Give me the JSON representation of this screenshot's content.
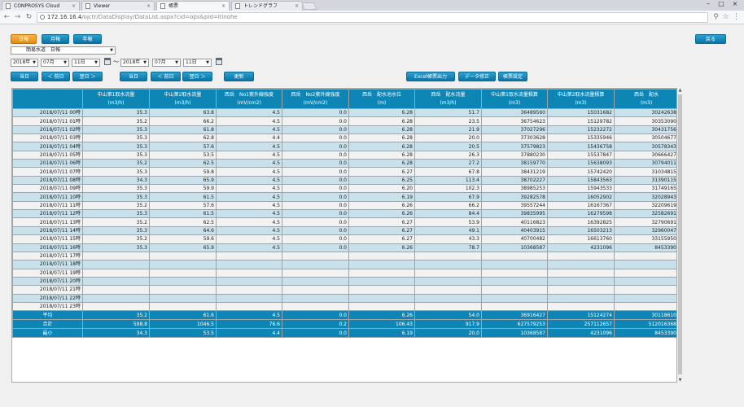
{
  "browser": {
    "tabs": [
      {
        "label": "CONPROSYS Cloud"
      },
      {
        "label": "Viewer"
      },
      {
        "label": "帳票"
      },
      {
        "label": "トレンドグラフ"
      }
    ],
    "address_host": "172.16.16.4",
    "address_path": "/ojctr/DataDisplay/DataList.aspx?cid=ops&pid=itinohe"
  },
  "controls": {
    "mode_daily": "日報",
    "mode_monthly": "月報",
    "mode_yearly": "年報",
    "back_button": "戻る",
    "facility_select": "簡易水道　日報",
    "from": {
      "year": "2018年",
      "month": "07月",
      "day": "11日"
    },
    "tilde": "～",
    "to": {
      "year": "2018年",
      "month": "07月",
      "day": "11日"
    },
    "from_today": "当日",
    "from_prev": "＜ 前日",
    "from_next": "翌日 ＞",
    "to_today": "当日",
    "to_prev": "＜ 前日",
    "to_next": "翌日 ＞",
    "refresh": "更新",
    "excel_export": "Excel帳票出力",
    "data_edit": "データ修正",
    "report_settings": "帳票設定"
  },
  "table": {
    "columns": [
      "",
      "中山第1取水流量\n(m3/h)",
      "中山第2取水流量\n(m3/h)",
      "西岳　No1紫外線強度\n(mV/cm2)",
      "西岳　No2紫外線強度\n(mV/cm2)",
      "西岳　配水池水位\n(m)",
      "西岳　配水流量\n(m3/h)",
      "中山第1取水流量積算\n(m3)",
      "中山第2取水流量積算\n(m3)",
      "西岳　配水\n(m3)"
    ],
    "rows": [
      [
        "2018/07/11 00時",
        "35.3",
        "63.8",
        "4.5",
        "0.0",
        "6.28",
        "51.7",
        "36489560",
        "15031682",
        "30242638"
      ],
      [
        "2018/07/11 01時",
        "35.2",
        "66.2",
        "4.5",
        "0.0",
        "6.28",
        "23.5",
        "36754623",
        "15129782",
        "30353090"
      ],
      [
        "2018/07/11 02時",
        "35.3",
        "61.8",
        "4.5",
        "0.0",
        "6.28",
        "21.9",
        "37027296",
        "15232272",
        "30431756"
      ],
      [
        "2018/07/11 03時",
        "35.3",
        "62.8",
        "4.4",
        "0.0",
        "6.28",
        "20.0",
        "37303628",
        "15335946",
        "30504677"
      ],
      [
        "2018/07/11 04時",
        "35.3",
        "57.6",
        "4.5",
        "0.0",
        "6.28",
        "20.5",
        "37579823",
        "15436758",
        "30578343"
      ],
      [
        "2018/07/11 05時",
        "35.3",
        "53.5",
        "4.5",
        "0.0",
        "6.28",
        "26.3",
        "37880230",
        "15537847",
        "30666427"
      ],
      [
        "2018/07/11 06時",
        "35.2",
        "62.5",
        "4.5",
        "0.0",
        "6.28",
        "27.2",
        "38159770",
        "15638093",
        "30794011"
      ],
      [
        "2018/07/11 07時",
        "35.3",
        "59.8",
        "4.5",
        "0.0",
        "6.27",
        "67.8",
        "38431219",
        "15742420",
        "31034815"
      ],
      [
        "2018/07/11 08時",
        "34.3",
        "65.9",
        "4.5",
        "0.0",
        "6.25",
        "113.4",
        "38702227",
        "15843563",
        "31390115"
      ],
      [
        "2018/07/11 09時",
        "35.3",
        "59.9",
        "4.5",
        "0.0",
        "6.20",
        "102.3",
        "38985253",
        "15943533",
        "31749165"
      ],
      [
        "2018/07/11 10時",
        "35.3",
        "61.5",
        "4.5",
        "0.0",
        "6.19",
        "67.9",
        "39282578",
        "16052902",
        "32028943"
      ],
      [
        "2018/07/11 11時",
        "35.2",
        "57.6",
        "4.5",
        "0.0",
        "6.26",
        "66.2",
        "39557244",
        "16167367",
        "32209619"
      ],
      [
        "2018/07/11 12時",
        "35.3",
        "61.5",
        "4.5",
        "0.0",
        "6.26",
        "84.4",
        "39835995",
        "16279598",
        "32582691"
      ],
      [
        "2018/07/11 13時",
        "35.2",
        "62.5",
        "4.5",
        "0.0",
        "6.27",
        "53.9",
        "40116823",
        "16392825",
        "32790691"
      ],
      [
        "2018/07/11 14時",
        "35.3",
        "64.6",
        "4.5",
        "0.0",
        "6.27",
        "49.1",
        "40403915",
        "16503213",
        "32960047"
      ],
      [
        "2018/07/11 15時",
        "35.2",
        "59.6",
        "4.5",
        "0.0",
        "6.27",
        "43.3",
        "40700482",
        "16613760",
        "33155950"
      ],
      [
        "2018/07/11 16時",
        "35.3",
        "65.9",
        "4.5",
        "0.0",
        "6.26",
        "78.7",
        "10368587",
        "4231096",
        "8453390"
      ],
      [
        "2018/07/11 17時",
        "",
        "",
        "",
        "",
        "",
        "",
        "",
        "",
        ""
      ],
      [
        "2018/07/11 18時",
        "",
        "",
        "",
        "",
        "",
        "",
        "",
        "",
        ""
      ],
      [
        "2018/07/11 19時",
        "",
        "",
        "",
        "",
        "",
        "",
        "",
        "",
        ""
      ],
      [
        "2018/07/11 20時",
        "",
        "",
        "",
        "",
        "",
        "",
        "",
        "",
        ""
      ],
      [
        "2018/07/11 21時",
        "",
        "",
        "",
        "",
        "",
        "",
        "",
        "",
        ""
      ],
      [
        "2018/07/11 22時",
        "",
        "",
        "",
        "",
        "",
        "",
        "",
        "",
        ""
      ],
      [
        "2018/07/11 23時",
        "",
        "",
        "",
        "",
        "",
        "",
        "",
        "",
        ""
      ]
    ],
    "summary": [
      [
        "平均",
        "35.2",
        "61.6",
        "4.5",
        "0.0",
        "6.26",
        "54.0",
        "36916427",
        "15124274",
        "30118610"
      ],
      [
        "合計",
        "598.8",
        "1046.5",
        "76.6",
        "0.2",
        "106.43",
        "917.9",
        "627579253",
        "257112657",
        "512016368"
      ],
      [
        "最小",
        "34.3",
        "53.5",
        "4.4",
        "0.0",
        "6.19",
        "20.0",
        "10368587",
        "4231096",
        "8453390"
      ]
    ]
  }
}
